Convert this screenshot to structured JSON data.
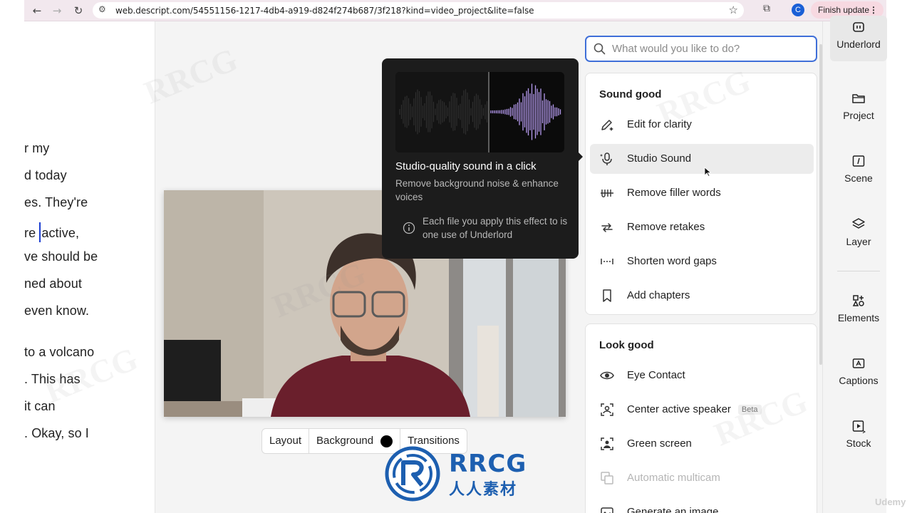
{
  "browser": {
    "url": "web.descript.com/54551156-1217-4db4-a919-d824f274b687/3f218?kind=video_project&lite=false",
    "avatar_letter": "C",
    "finish_update_label": "Finish update",
    "icons": [
      "back-arrow-icon",
      "forward-arrow-icon",
      "reload-icon",
      "site-settings-icon",
      "star-icon",
      "extensions-icon",
      "more-icon"
    ]
  },
  "transcript": {
    "lines": [
      "r my",
      "d today",
      "es. They're",
      "re",
      "active,",
      "ve should be",
      "ned about",
      "even know.",
      "to a volcano",
      ". This has",
      " it can",
      ". Okay, so I"
    ]
  },
  "canvas": {
    "toolbar": {
      "layout_label": "Layout",
      "background_label": "Background",
      "background_color": "#000000",
      "transitions_label": "Transitions"
    }
  },
  "tooltip": {
    "title": "Studio-quality sound in a click",
    "description": "Remove background noise & enhance voices",
    "note": "Each file you apply this effect to is one use of Underlord",
    "wave_color": "#b79cf0"
  },
  "panel": {
    "search_placeholder": "What would you like to do?",
    "sound_good": {
      "title": "Sound good",
      "items": [
        {
          "label": "Edit for clarity",
          "icon": "pen-sparkle-icon"
        },
        {
          "label": "Studio Sound",
          "icon": "mic-sparkle-icon",
          "highlighted": true
        },
        {
          "label": "Remove filler words",
          "icon": "filler-words-icon"
        },
        {
          "label": "Remove retakes",
          "icon": "retakes-icon"
        },
        {
          "label": "Shorten word gaps",
          "icon": "word-gaps-icon"
        },
        {
          "label": "Add chapters",
          "icon": "bookmark-icon"
        }
      ]
    },
    "look_good": {
      "title": "Look good",
      "items": [
        {
          "label": "Eye Contact",
          "icon": "eye-icon"
        },
        {
          "label": "Center active speaker",
          "icon": "center-speaker-icon",
          "badge": "Beta"
        },
        {
          "label": "Green screen",
          "icon": "green-screen-icon"
        },
        {
          "label": "Automatic multicam",
          "icon": "multicam-icon",
          "disabled": true
        },
        {
          "label": "Generate an image",
          "icon": "image-sparkle-icon"
        }
      ]
    }
  },
  "sidebar": {
    "items": [
      {
        "label": "Underlord",
        "icon": "underlord-icon",
        "active": true
      },
      {
        "label": "Project",
        "icon": "folder-icon"
      },
      {
        "label": "Scene",
        "icon": "scene-icon"
      },
      {
        "label": "Layer",
        "icon": "layers-icon"
      },
      {
        "label": "Elements",
        "icon": "elements-icon"
      },
      {
        "label": "Captions",
        "icon": "captions-icon"
      },
      {
        "label": "Stock",
        "icon": "stock-icon"
      }
    ]
  },
  "watermark": {
    "logo_text": "RRCG",
    "logo_subtext": "人人素材",
    "corner_text": "Udemy",
    "accent": "#1d5fb0"
  }
}
